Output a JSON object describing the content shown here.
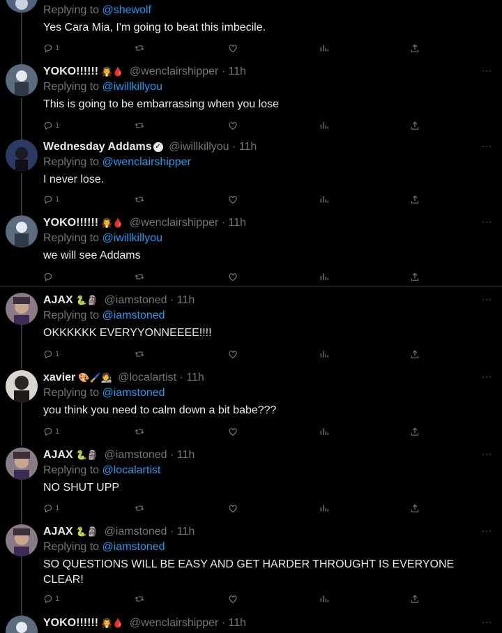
{
  "colors": {
    "background": "#000000",
    "text": "#e7e9ea",
    "muted": "#71767b",
    "link": "#1d9bf0"
  },
  "top_tweet": {
    "reply_prefix": "Replying to",
    "reply_to": "@shewolf",
    "text": "Yes Cara Mia, I'm going to beat this imbecile.",
    "reply_count": "1"
  },
  "tweets": [
    {
      "name": "YOKO!!!!!!",
      "emoji": "🧛🩸",
      "handle": "@wenclairshipper · 11h",
      "reply_prefix": "Replying to",
      "reply_to": "@iwillkillyou",
      "text": "This is going to be embarrassing when you lose",
      "reply_count": "1"
    },
    {
      "name": "Wednesday Addams",
      "verified": "✓",
      "handle": "@iwillkillyou · 11h",
      "reply_prefix": "Replying to",
      "reply_to": "@wenclairshipper",
      "text": "I never lose.",
      "reply_count": "1"
    },
    {
      "name": "YOKO!!!!!!",
      "emoji": "🧛🩸",
      "handle": "@wenclairshipper · 11h",
      "reply_prefix": "Replying to",
      "reply_to": "@iwillkillyou",
      "text": "we will see Addams",
      "reply_count": ""
    },
    {
      "name": "AJAX",
      "emoji": "🐍🗿",
      "handle": "@iamstoned · 11h",
      "reply_prefix": "Replying to",
      "reply_to": "@iamstoned",
      "text": "OKKKKKK EVERYYONNEEEE!!!!",
      "reply_count": "1"
    },
    {
      "name": "xavier",
      "emoji": "🎨🖌️🧑‍🎨",
      "handle": "@localartist · 11h",
      "reply_prefix": "Replying to",
      "reply_to": "@iamstoned",
      "text": "you think you need to calm down a bit babe???",
      "reply_count": "1"
    },
    {
      "name": "AJAX",
      "emoji": "🐍🗿",
      "handle": "@iamstoned · 11h",
      "reply_prefix": "Replying to",
      "reply_to": "@localartist",
      "text": "NO SHUT UPP",
      "reply_count": "1"
    },
    {
      "name": "AJAX",
      "emoji": "🐍🗿",
      "handle": "@iamstoned · 11h",
      "reply_prefix": "Replying to",
      "reply_to": "@iamstoned",
      "text": "SO QUESTIONS WILL BE EASY AND GET HARDER THROUGHT IS EVERYONE CLEAR!",
      "reply_count": "1"
    }
  ],
  "bottom_tweet": {
    "name": "YOKO!!!!!!",
    "emoji": "🧛🩸",
    "handle": "@wenclairshipper · 11h"
  },
  "more_label": "···"
}
